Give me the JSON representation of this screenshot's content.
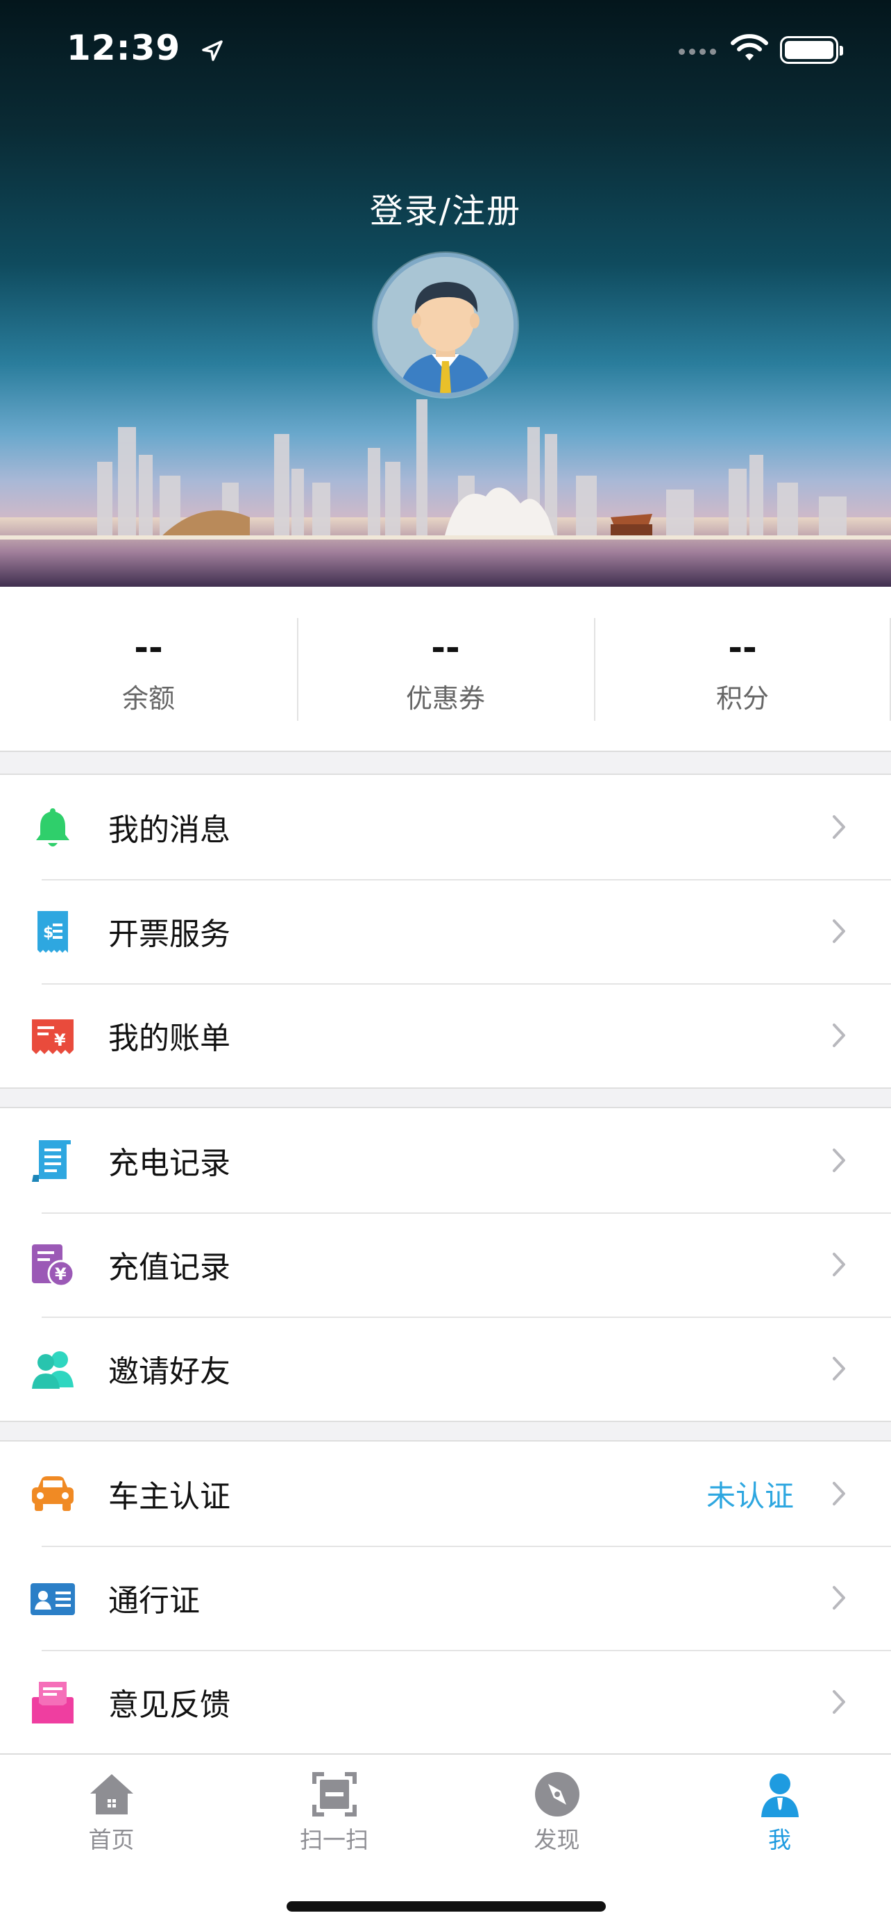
{
  "status_bar": {
    "time": "12:39"
  },
  "header": {
    "login_label": "登录/注册"
  },
  "stats": [
    {
      "value": "--",
      "label": "余额"
    },
    {
      "value": "--",
      "label": "优惠券"
    },
    {
      "value": "--",
      "label": "积分"
    }
  ],
  "menu": {
    "group1": [
      {
        "label": "我的消息",
        "icon": "bell-icon",
        "color": "#2fcf6b"
      },
      {
        "label": "开票服务",
        "icon": "invoice-icon",
        "color": "#2ea7e0"
      },
      {
        "label": "我的账单",
        "icon": "bill-icon",
        "color": "#e94b3c"
      }
    ],
    "group2": [
      {
        "label": "充电记录",
        "icon": "charge-record-icon",
        "color": "#2ea7e0"
      },
      {
        "label": "充值记录",
        "icon": "recharge-record-icon",
        "color": "#9b59b6"
      },
      {
        "label": "邀请好友",
        "icon": "invite-friends-icon",
        "color": "#2fd6c0"
      }
    ],
    "group3": [
      {
        "label": "车主认证",
        "icon": "car-icon",
        "color": "#f08a24",
        "status": "未认证"
      },
      {
        "label": "通行证",
        "icon": "id-card-icon",
        "color": "#2b7fc7"
      },
      {
        "label": "意见反馈",
        "icon": "feedback-mail-icon",
        "color": "#ef3ea0"
      }
    ]
  },
  "tabbar": [
    {
      "label": "首页",
      "icon": "home-icon"
    },
    {
      "label": "扫一扫",
      "icon": "scan-icon"
    },
    {
      "label": "发现",
      "icon": "compass-icon"
    },
    {
      "label": "我",
      "icon": "user-icon",
      "active": true
    }
  ],
  "colors": {
    "accent": "#1e9be0",
    "status_link": "#2ea7e0"
  }
}
